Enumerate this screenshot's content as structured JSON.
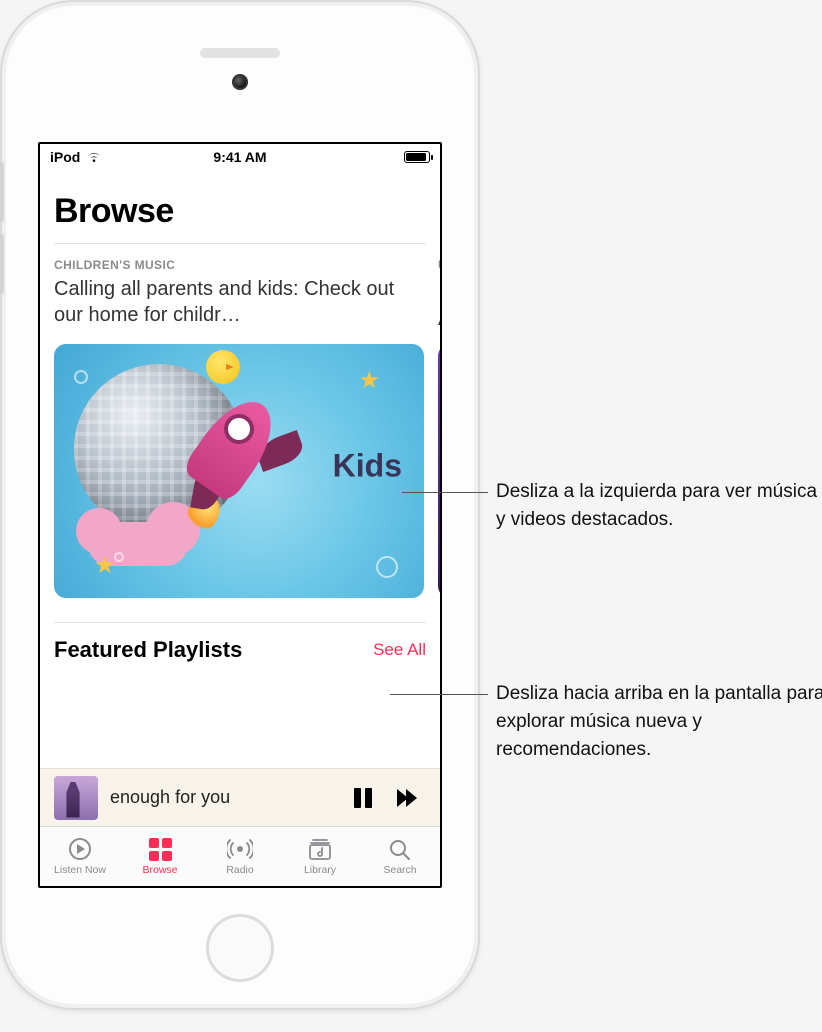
{
  "status_bar": {
    "device": "iPod",
    "time": "9:41 AM"
  },
  "browse": {
    "title": "Browse",
    "hero": {
      "eyebrow": "CHILDREN'S MUSIC",
      "title": "Calling all parents and kids: Check out our home for childr…",
      "artwork_label": "Kids"
    },
    "peek": {
      "eyebrow": "U",
      "title_line1": "¡",
      "title_line2": "A"
    },
    "featured": {
      "title": "Featured Playlists",
      "see_all": "See All"
    }
  },
  "now_playing": {
    "title": "enough for you"
  },
  "tabs": {
    "listen_now": "Listen Now",
    "browse": "Browse",
    "radio": "Radio",
    "library": "Library",
    "search": "Search"
  },
  "callouts": {
    "c1": "Desliza a la izquierda para ver música y videos destacados.",
    "c2": "Desliza hacia arriba en la pantalla para explorar música nueva y recomendaciones."
  }
}
